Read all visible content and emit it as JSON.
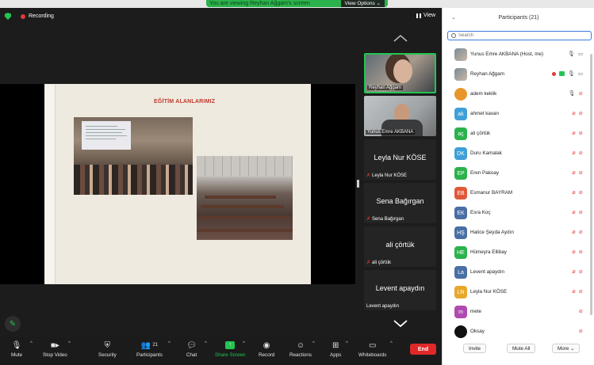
{
  "share_banner": {
    "text": "You are viewing Reyhan Ağgam's screen",
    "view_options": "View Options"
  },
  "meeting": {
    "recording_label": "Recording",
    "view_label": "View"
  },
  "slide": {
    "title": "EĞİTİM ALANLARIMIZ"
  },
  "video_tiles": [
    {
      "name": "Reyhan Ağgam",
      "type": "camera",
      "active_speaker": true
    },
    {
      "name": "Yunus Emre AKBANA",
      "type": "camera"
    },
    {
      "name": "Leyla Nur KÖSE",
      "small_name": "Leyla Nur KÖSE",
      "muted": true
    },
    {
      "name": "Sena Bağırgan",
      "small_name": "Sena Bağırgan",
      "muted": true
    },
    {
      "name": "ali çörtük",
      "small_name": "ali çörtük",
      "muted": true
    },
    {
      "name": "Levent apaydın",
      "small_name": "Levent apaydın",
      "muted": false
    }
  ],
  "toolbar": {
    "mute": "Mute",
    "stop_video": "Stop Video",
    "security": "Security",
    "participants": "Participants",
    "participants_count": "21",
    "chat": "Chat",
    "share_screen": "Share Screen",
    "record": "Record",
    "reactions": "Reactions",
    "apps": "Apps",
    "whiteboards": "Whiteboards",
    "end": "End"
  },
  "panel": {
    "title": "Participants (21)",
    "search_placeholder": "Search",
    "participants": [
      {
        "name": "Yunus Emre AKBANA (Host, me)",
        "initials": "",
        "color": "",
        "photo": true,
        "mic": "on",
        "cam": "on"
      },
      {
        "name": "Reyhan Ağgam",
        "initials": "",
        "color": "",
        "photo": true,
        "mic": "on",
        "cam": "on",
        "recording": true,
        "sharing": true
      },
      {
        "name": "adem keklik",
        "initials": "",
        "color": "#e8962a",
        "photo": false,
        "mic": "on",
        "cam": "off"
      },
      {
        "name": "ahmet kavan",
        "initials": "ak",
        "color": "#3f9fd8",
        "mic": "off",
        "cam": "off"
      },
      {
        "name": "ali çörtük",
        "initials": "aç",
        "color": "#2bb24c",
        "mic": "off",
        "cam": "off"
      },
      {
        "name": "Duru Kamalak",
        "initials": "DK",
        "color": "#3f9fd8",
        "mic": "off",
        "cam": "off"
      },
      {
        "name": "Eren Pakoay",
        "initials": "EP",
        "color": "#2bb24c",
        "mic": "off",
        "cam": "off"
      },
      {
        "name": "Esmanur BAYRAM",
        "initials": "EB",
        "color": "#e05a3a",
        "mic": "off",
        "cam": "off"
      },
      {
        "name": "Esra Koç",
        "initials": "EK",
        "color": "#4a6fa5",
        "mic": "off",
        "cam": "off"
      },
      {
        "name": "Hatice Şeyda Aydın",
        "initials": "HŞ",
        "color": "#4a6fa5",
        "mic": "off",
        "cam": "off"
      },
      {
        "name": "Hümeyra Ellibay",
        "initials": "HE",
        "color": "#2bb24c",
        "mic": "off",
        "cam": "off"
      },
      {
        "name": "Levent apaydın",
        "initials": "La",
        "color": "#4a6fa5",
        "mic": "off",
        "cam": "off"
      },
      {
        "name": "Leyla Nur KÖSE",
        "initials": "LN",
        "color": "#e8a82a",
        "mic": "off",
        "cam": "off"
      },
      {
        "name": "mete",
        "initials": "m",
        "color": "#b04ab0",
        "mic": "none",
        "cam": "off"
      },
      {
        "name": "Oksay",
        "initials": "",
        "color": "#111111",
        "mic": "none",
        "cam": "off"
      }
    ],
    "invite": "Invite",
    "mute_all": "Mute All",
    "more": "More"
  },
  "colors": {
    "accent_green": "#23c552",
    "end_red": "#e02828",
    "mute_red": "#e03a3a",
    "search_blue": "#3a7be0"
  }
}
